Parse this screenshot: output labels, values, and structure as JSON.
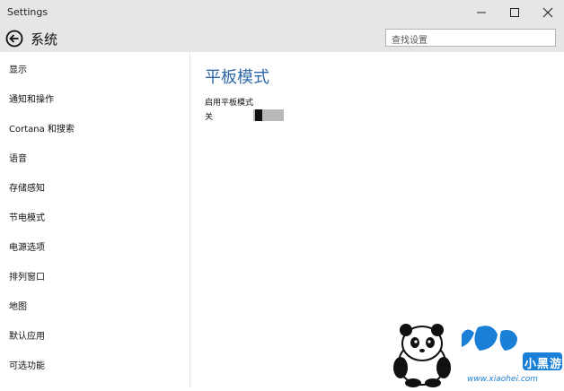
{
  "window": {
    "title": "Settings"
  },
  "header": {
    "section": "系统",
    "search_placeholder": "查找设置"
  },
  "sidebar": {
    "items": [
      {
        "label": "显示"
      },
      {
        "label": "通知和操作"
      },
      {
        "label": "Cortana 和搜索"
      },
      {
        "label": "语音"
      },
      {
        "label": "存储感知"
      },
      {
        "label": "节电模式"
      },
      {
        "label": "电源选项"
      },
      {
        "label": "排列窗口"
      },
      {
        "label": "地图"
      },
      {
        "label": "默认应用"
      },
      {
        "label": "可选功能"
      }
    ]
  },
  "main": {
    "title": "平板模式",
    "setting_label": "启用平板模式",
    "toggle_state": "关",
    "toggle_on": false
  },
  "watermark": {
    "brand": "小黑游戏",
    "url": "www.xiaohei.com"
  },
  "colors": {
    "accent": "#2f68a8",
    "chrome": "#e6e6e6",
    "watermark_blue": "#1a7fd6"
  },
  "icons": [
    "back-arrow-icon",
    "minimize-icon",
    "maximize-icon",
    "close-icon",
    "panda-logo"
  ]
}
